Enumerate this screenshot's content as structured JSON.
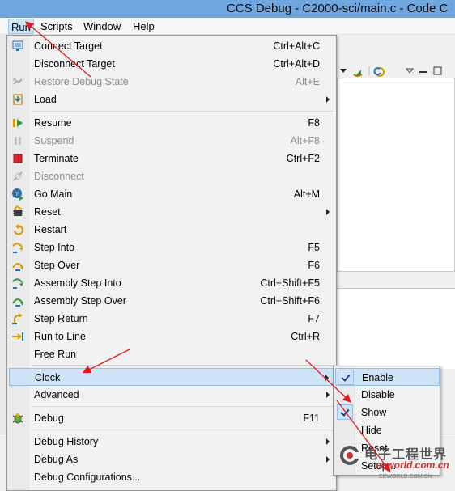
{
  "window": {
    "title": "CCS Debug - C2000-sci/main.c - Code C"
  },
  "menubar": [
    {
      "label": "Run",
      "active": true
    },
    {
      "label": "Scripts",
      "active": false
    },
    {
      "label": "Window",
      "active": false
    },
    {
      "label": "Help",
      "active": false
    }
  ],
  "run_menu": {
    "items": [
      {
        "icon": "connect-target-icon",
        "label": "Connect Target",
        "shortcut": "Ctrl+Alt+C",
        "enabled": true
      },
      {
        "icon": "",
        "label": "Disconnect Target",
        "shortcut": "Ctrl+Alt+D",
        "enabled": true
      },
      {
        "icon": "restore-debug-state-icon",
        "label": "Restore Debug State",
        "shortcut": "Alt+E",
        "enabled": false
      },
      {
        "icon": "load-icon",
        "label": "Load",
        "shortcut": "",
        "enabled": true,
        "submenu": true
      },
      {
        "icon": "resume-icon",
        "label": "Resume",
        "shortcut": "F8",
        "enabled": true
      },
      {
        "icon": "suspend-icon",
        "label": "Suspend",
        "shortcut": "Alt+F8",
        "enabled": false
      },
      {
        "icon": "terminate-icon",
        "label": "Terminate",
        "shortcut": "Ctrl+F2",
        "enabled": true
      },
      {
        "icon": "disconnect-icon",
        "label": "Disconnect",
        "shortcut": "",
        "enabled": false
      },
      {
        "icon": "go-main-icon",
        "label": "Go Main",
        "shortcut": "Alt+M",
        "enabled": true
      },
      {
        "icon": "reset-icon",
        "label": "Reset",
        "shortcut": "",
        "enabled": true,
        "submenu": true
      },
      {
        "icon": "restart-icon",
        "label": "Restart",
        "shortcut": "",
        "enabled": true
      },
      {
        "icon": "step-into-icon",
        "label": "Step Into",
        "shortcut": "F5",
        "enabled": true
      },
      {
        "icon": "step-over-icon",
        "label": "Step Over",
        "shortcut": "F6",
        "enabled": true
      },
      {
        "icon": "assembly-step-into-icon",
        "label": "Assembly Step Into",
        "shortcut": "Ctrl+Shift+F5",
        "enabled": true
      },
      {
        "icon": "assembly-step-over-icon",
        "label": "Assembly Step Over",
        "shortcut": "Ctrl+Shift+F6",
        "enabled": true
      },
      {
        "icon": "step-return-icon",
        "label": "Step Return",
        "shortcut": "F7",
        "enabled": true
      },
      {
        "icon": "run-to-line-icon",
        "label": "Run to Line",
        "shortcut": "Ctrl+R",
        "enabled": true
      },
      {
        "icon": "",
        "label": "Free Run",
        "shortcut": "",
        "enabled": true
      },
      {
        "icon": "",
        "label": "Clock",
        "shortcut": "",
        "enabled": true,
        "submenu": true,
        "highlighted": true
      },
      {
        "icon": "",
        "label": "Advanced",
        "shortcut": "",
        "enabled": true,
        "submenu": true
      },
      {
        "icon": "debug-icon",
        "label": "Debug",
        "shortcut": "F11",
        "enabled": true
      },
      {
        "icon": "",
        "label": "Debug History",
        "shortcut": "",
        "enabled": true,
        "submenu": true
      },
      {
        "icon": "",
        "label": "Debug As",
        "shortcut": "",
        "enabled": true,
        "submenu": true
      },
      {
        "icon": "",
        "label": "Debug Configurations...",
        "shortcut": "",
        "enabled": true
      }
    ]
  },
  "clock_submenu": {
    "items": [
      {
        "label": "Enable",
        "checked": true,
        "highlighted": true
      },
      {
        "label": "Disable",
        "checked": false
      },
      {
        "label": "Show",
        "checked": true
      },
      {
        "label": "Hide",
        "checked": false
      },
      {
        "label": "Reset",
        "checked": false
      },
      {
        "label": "Setup...",
        "checked": false
      }
    ]
  },
  "watermark": {
    "cn": "电子工程世界",
    "en": "eeworld.com.cn",
    "tiny": "EEWORLD.COM.CN"
  },
  "colors": {
    "titlebar": "#6fa6de",
    "highlight": "#cfe3f7",
    "highlight_border": "#8fbff0",
    "annotation_arrow": "#e01b1b",
    "disabled_text": "#8d8d8d"
  }
}
